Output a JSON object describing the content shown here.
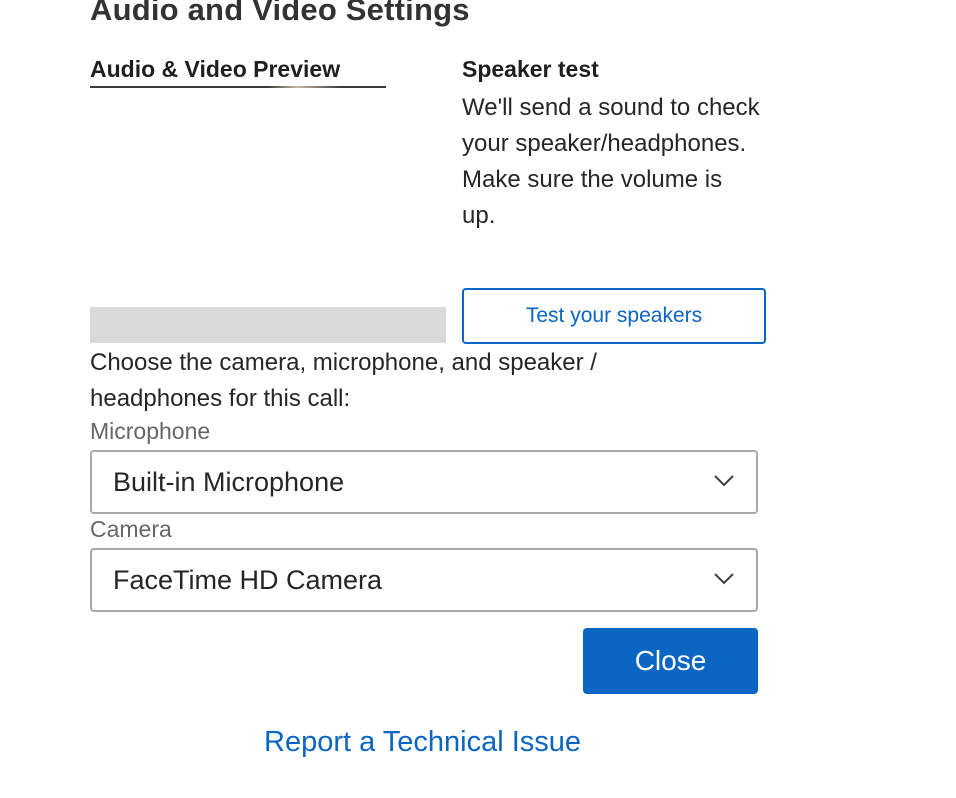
{
  "dialog": {
    "title": "Audio and Video Settings"
  },
  "preview": {
    "heading": "Audio & Video Preview",
    "mic_level": 0
  },
  "speaker_test": {
    "heading": "Speaker test",
    "description": "We'll send a sound to check your speaker/headphones. Make sure the volume is up.",
    "button_label": "Test your speakers"
  },
  "devices": {
    "instructions": "Choose the camera, microphone, and speaker / headphones for this call:",
    "microphone": {
      "label": "Microphone",
      "selected": "Built-in Microphone",
      "icon": "chevron-down-icon"
    },
    "camera": {
      "label": "Camera",
      "selected": "FaceTime HD Camera",
      "icon": "chevron-down-icon"
    }
  },
  "actions": {
    "close_label": "Close",
    "report_label": "Report a Technical Issue"
  },
  "colors": {
    "accent": "#0a66c2",
    "level_track": "#d9d9d9"
  }
}
